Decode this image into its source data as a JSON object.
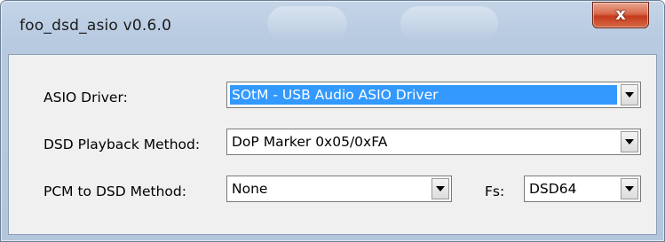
{
  "window": {
    "title": "foo_dsd_asio v0.6.0",
    "close_glyph": "x"
  },
  "form": {
    "asio_driver": {
      "label": "ASIO Driver:",
      "value": "SOtM - USB Audio ASIO Driver"
    },
    "dsd_playback": {
      "label": "DSD Playback Method:",
      "value": "DoP Marker 0x05/0xFA"
    },
    "pcm_to_dsd": {
      "label": "PCM to DSD Method:",
      "value": "None"
    },
    "fs": {
      "label": "Fs:",
      "value": "DSD64"
    }
  },
  "icons": {
    "close": "close-icon",
    "dropdown": "chevron-down-icon"
  },
  "colors": {
    "title_bar": "#b9cbe1",
    "close_button": "#c43a1c",
    "selection": "#3399ff",
    "client_bg": "#f0f0f0"
  }
}
